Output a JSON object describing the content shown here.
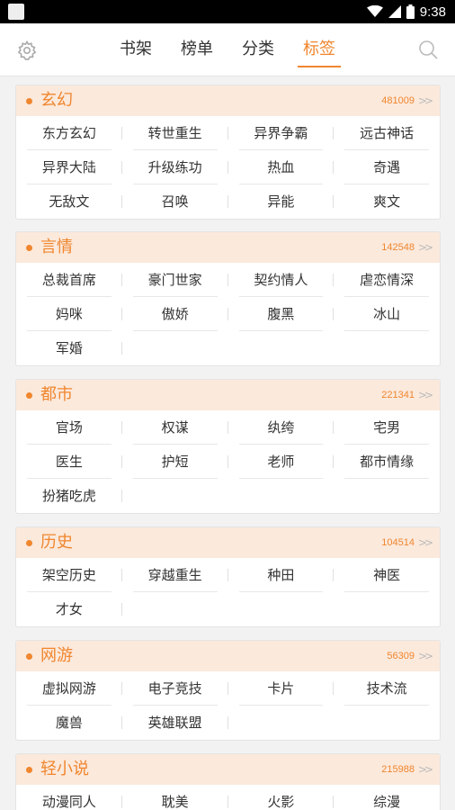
{
  "status": {
    "time": "9:38"
  },
  "nav": {
    "tabs": [
      {
        "label": "书架",
        "active": false
      },
      {
        "label": "榜单",
        "active": false
      },
      {
        "label": "分类",
        "active": false
      },
      {
        "label": "标签",
        "active": true
      }
    ]
  },
  "colors": {
    "accent": "#f0862e",
    "header_bg": "#fbe9dc"
  },
  "categories": [
    {
      "title": "玄幻",
      "count": "481009",
      "tags": [
        "东方玄幻",
        "转世重生",
        "异界争霸",
        "远古神话",
        "异界大陆",
        "升级练功",
        "热血",
        "奇遇",
        "无敌文",
        "召唤",
        "异能",
        "爽文"
      ]
    },
    {
      "title": "言情",
      "count": "142548",
      "tags": [
        "总裁首席",
        "豪门世家",
        "契约情人",
        "虐恋情深",
        "妈咪",
        "傲娇",
        "腹黑",
        "冰山",
        "军婚"
      ]
    },
    {
      "title": "都市",
      "count": "221341",
      "tags": [
        "官场",
        "权谋",
        "纨绔",
        "宅男",
        "医生",
        "护短",
        "老师",
        "都市情缘",
        "扮猪吃虎"
      ]
    },
    {
      "title": "历史",
      "count": "104514",
      "tags": [
        "架空历史",
        "穿越重生",
        "种田",
        "神医",
        "才女"
      ]
    },
    {
      "title": "网游",
      "count": "56309",
      "tags": [
        "虚拟网游",
        "电子竞技",
        "卡片",
        "技术流",
        "魔兽",
        "英雄联盟"
      ]
    },
    {
      "title": "轻小说",
      "count": "215988",
      "tags": [
        "动漫同人",
        "耽美",
        "火影",
        "综漫"
      ]
    }
  ]
}
